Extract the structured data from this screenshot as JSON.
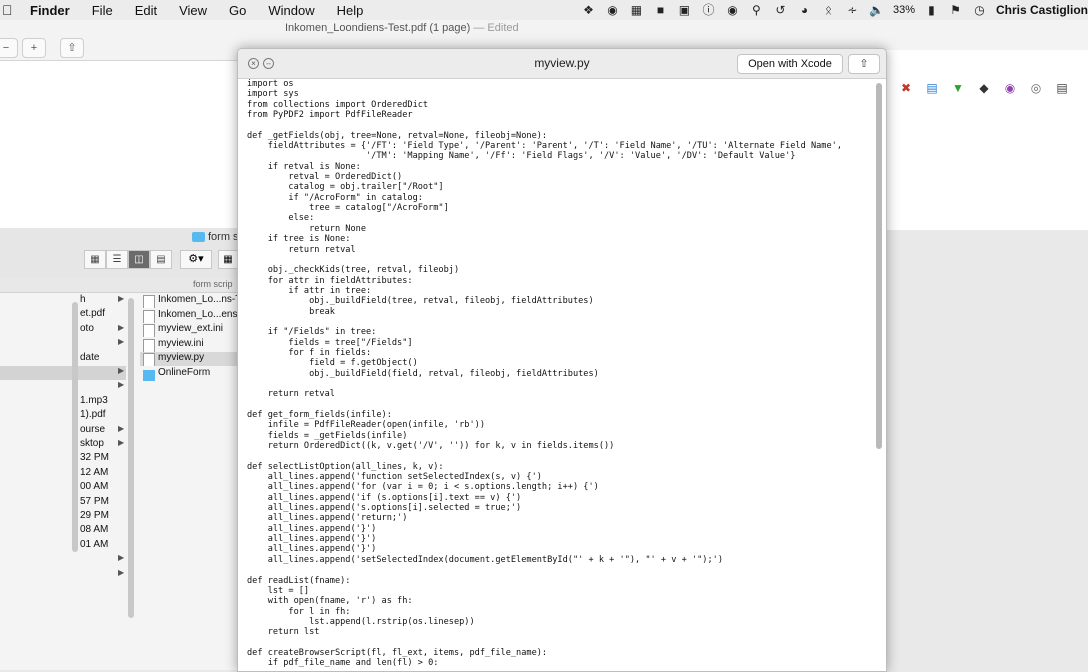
{
  "menubar": {
    "items": [
      "Finder",
      "File",
      "Edit",
      "View",
      "Go",
      "Window",
      "Help"
    ],
    "battery": "33%",
    "user": "Chris Castiglion"
  },
  "pdf_window": {
    "title": "Inkomen_Loondiens-Test.pdf (1 page)",
    "edited": "— Edited"
  },
  "finder": {
    "folder": "form s",
    "column_header": "form scrip",
    "col1": [
      {
        "text": "h",
        "arrow": true,
        "selected": false
      },
      {
        "text": "et.pdf",
        "arrow": false,
        "selected": false
      },
      {
        "text": "oto",
        "arrow": true,
        "selected": false
      },
      {
        "text": "",
        "arrow": true,
        "selected": false
      },
      {
        "text": "date",
        "arrow": false,
        "selected": false
      },
      {
        "text": "",
        "arrow": true,
        "selected": true
      },
      {
        "text": "",
        "arrow": true,
        "selected": false
      },
      {
        "text": "1.mp3",
        "arrow": false,
        "selected": false
      },
      {
        "text": "1).pdf",
        "arrow": false,
        "selected": false
      },
      {
        "text": "ourse",
        "arrow": true,
        "selected": false
      },
      {
        "text": "sktop",
        "arrow": true,
        "selected": false
      },
      {
        "text": "32 PM",
        "arrow": false,
        "selected": false
      },
      {
        "text": "12 AM",
        "arrow": false,
        "selected": false
      },
      {
        "text": "00 AM",
        "arrow": false,
        "selected": false
      },
      {
        "text": "57 PM",
        "arrow": false,
        "selected": false
      },
      {
        "text": "29 PM",
        "arrow": false,
        "selected": false
      },
      {
        "text": "08 AM",
        "arrow": false,
        "selected": false
      },
      {
        "text": "01 AM",
        "arrow": false,
        "selected": false
      },
      {
        "text": "",
        "arrow": true,
        "selected": false
      },
      {
        "text": "",
        "arrow": true,
        "selected": false
      }
    ],
    "col2": [
      {
        "name": "Inkomen_Lo...ns-T",
        "kind": "file",
        "selected": false
      },
      {
        "name": "Inkomen_Lo...ens",
        "kind": "file",
        "selected": false
      },
      {
        "name": "myview_ext.ini",
        "kind": "file",
        "selected": false
      },
      {
        "name": "myview.ini",
        "kind": "file",
        "selected": false
      },
      {
        "name": "myview.py",
        "kind": "file",
        "selected": true
      },
      {
        "name": "OnlineForm",
        "kind": "folder",
        "selected": false
      }
    ]
  },
  "quicklook": {
    "title": "myview.py",
    "open_button": "Open with Xcode",
    "code": "import os\nimport sys\nfrom collections import OrderedDict\nfrom PyPDF2 import PdfFileReader\n\ndef _getFields(obj, tree=None, retval=None, fileobj=None):\n    fieldAttributes = {'/FT': 'Field Type', '/Parent': 'Parent', '/T': 'Field Name', '/TU': 'Alternate Field Name',\n                       '/TM': 'Mapping Name', '/Ff': 'Field Flags', '/V': 'Value', '/DV': 'Default Value'}\n    if retval is None:\n        retval = OrderedDict()\n        catalog = obj.trailer[\"/Root\"]\n        if \"/AcroForm\" in catalog:\n            tree = catalog[\"/AcroForm\"]\n        else:\n            return None\n    if tree is None:\n        return retval\n\n    obj._checkKids(tree, retval, fileobj)\n    for attr in fieldAttributes:\n        if attr in tree:\n            obj._buildField(tree, retval, fileobj, fieldAttributes)\n            break\n\n    if \"/Fields\" in tree:\n        fields = tree[\"/Fields\"]\n        for f in fields:\n            field = f.getObject()\n            obj._buildField(field, retval, fileobj, fieldAttributes)\n\n    return retval\n\ndef get_form_fields(infile):\n    infile = PdfFileReader(open(infile, 'rb'))\n    fields = _getFields(infile)\n    return OrderedDict((k, v.get('/V', '')) for k, v in fields.items())\n\ndef selectListOption(all_lines, k, v):\n    all_lines.append('function setSelectedIndex(s, v) {')\n    all_lines.append('for (var i = 0; i < s.options.length; i++) {')\n    all_lines.append('if (s.options[i].text == v) {')\n    all_lines.append('s.options[i].selected = true;')\n    all_lines.append('return;')\n    all_lines.append('}')\n    all_lines.append('}')\n    all_lines.append('}')\n    all_lines.append('setSelectedIndex(document.getElementById(\"' + k + '\"), \"' + v + '\");')\n\ndef readList(fname):\n    lst = []\n    with open(fname, 'r') as fh:\n        for l in fh:\n            lst.append(l.rstrip(os.linesep))\n    return lst\n\ndef createBrowserScript(fl, fl_ext, items, pdf_file_name):\n    if pdf_file_name and len(fl) > 0:"
  }
}
